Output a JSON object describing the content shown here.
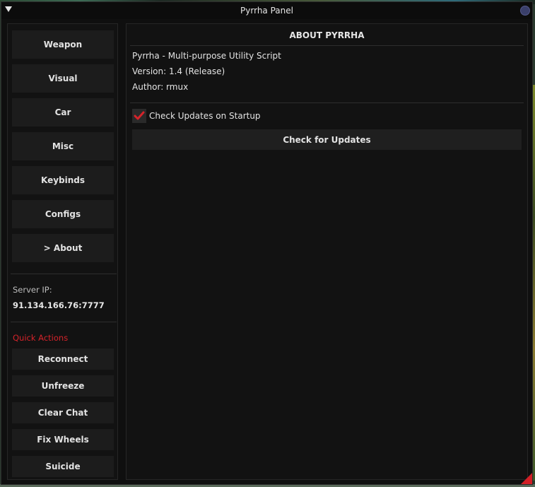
{
  "window": {
    "title": "Pyrrha Panel"
  },
  "sidebar": {
    "nav": [
      {
        "label": "Weapon"
      },
      {
        "label": "Visual"
      },
      {
        "label": "Car"
      },
      {
        "label": "Misc"
      },
      {
        "label": "Keybinds"
      },
      {
        "label": "Configs"
      },
      {
        "label": "> About"
      }
    ],
    "server_ip_label": "Server IP:",
    "server_ip": "91.134.166.76:7777",
    "quick_actions_label": "Quick Actions",
    "quick_actions": [
      {
        "label": "Reconnect"
      },
      {
        "label": "Unfreeze"
      },
      {
        "label": "Clear Chat"
      },
      {
        "label": "Fix Wheels"
      },
      {
        "label": "Suicide"
      }
    ]
  },
  "about": {
    "title": "ABOUT PYRRHA",
    "description": "Pyrrha - Multi-purpose Utility Script",
    "version": "Version: 1.4 (Release)",
    "author": "Author: rmux",
    "check_updates_on_startup_label": "Check Updates on Startup",
    "check_updates_on_startup": true,
    "check_for_updates_button": "Check for Updates"
  },
  "colors": {
    "accent": "#d5232a",
    "panel_bg": "#121212",
    "button_bg": "#1c1c1c",
    "text": "#e6e6e6"
  }
}
